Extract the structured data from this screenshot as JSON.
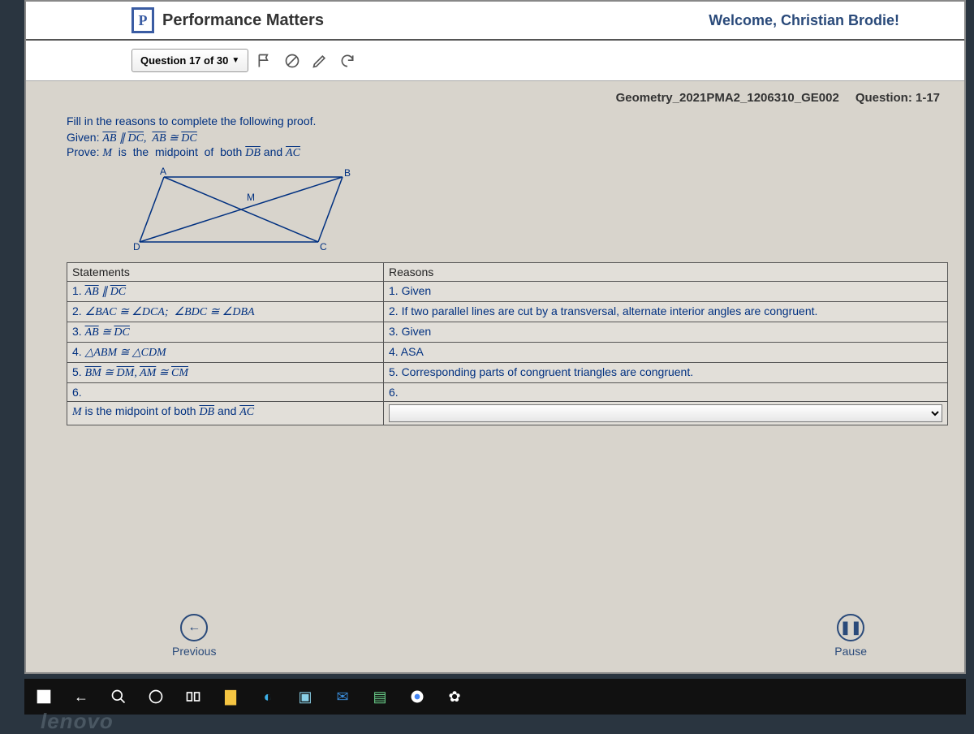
{
  "header": {
    "brand": "Performance Matters",
    "welcome": "Welcome, Christian Brodie!"
  },
  "toolbar": {
    "question_label": "Question 17 of 30"
  },
  "meta": {
    "assessment": "Geometry_2021PMA2_1206310_GE002",
    "question_num": "Question: 1-17"
  },
  "question": {
    "instruction": "Fill in the reasons to complete the following proof.",
    "given_prefix": "Given: ",
    "prove_prefix": "Prove: ",
    "figure_labels": {
      "A": "A",
      "B": "B",
      "C": "C",
      "D": "D",
      "M": "M"
    }
  },
  "proof": {
    "headers": {
      "statements": "Statements",
      "reasons": "Reasons"
    },
    "rows": [
      {
        "s_num": "1.",
        "r": "1. Given"
      },
      {
        "s_num": "2.",
        "r": "2. If two parallel lines are cut by a transversal, alternate interior angles are congruent."
      },
      {
        "s_num": "3.",
        "r": "3. Given"
      },
      {
        "s_num": "4.",
        "r": "4. ASA"
      },
      {
        "s_num": "5.",
        "r": "5. Corresponding parts of congruent triangles are congruent."
      },
      {
        "s_num": "6.",
        "r": "6."
      }
    ]
  },
  "nav": {
    "previous": "Previous",
    "pause": "Pause"
  },
  "brand_footer": "lenovo"
}
